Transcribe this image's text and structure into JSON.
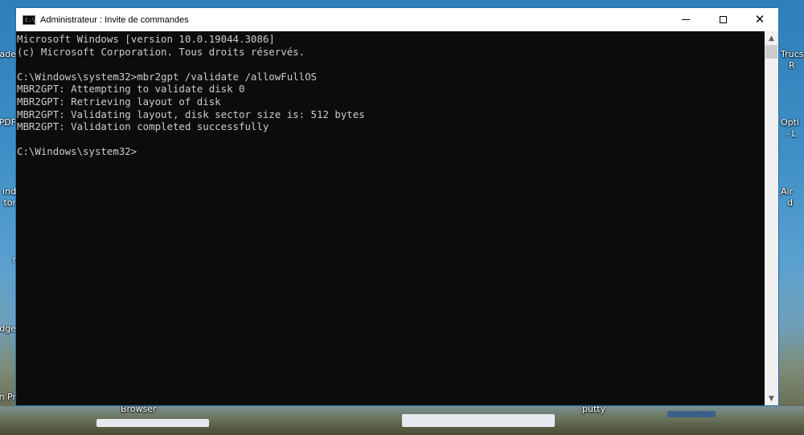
{
  "window": {
    "title": "Administrateur : Invite de commandes",
    "icon": "console-icon",
    "controls": [
      "minimize-icon",
      "maximize-icon",
      "close-icon"
    ]
  },
  "console": {
    "lines": [
      "Microsoft Windows [version 10.0.19044.3086]",
      "(c) Microsoft Corporation. Tous droits réservés.",
      "",
      "C:\\Windows\\system32>mbr2gpt /validate /allowFullOS",
      "MBR2GPT: Attempting to validate disk 0",
      "MBR2GPT: Retrieving layout of disk",
      "MBR2GPT: Validating layout, disk sector size is: 512 bytes",
      "MBR2GPT: Validation completed successfully",
      "",
      "C:\\Windows\\system32>"
    ]
  },
  "desktop": {
    "left_labels": [
      "ade",
      "PDF",
      "ind",
      "tor",
      "r",
      "Edge",
      "n Pr"
    ],
    "right_labels": [
      "Trucs",
      "R",
      "Opti",
      "- L",
      "Air",
      "d"
    ],
    "bottom_labels": [
      "Browser",
      "putty"
    ]
  },
  "colors": {
    "console_bg": "#0c0c0c",
    "console_fg": "#cccccc",
    "window_border": "#1e6fb4"
  }
}
